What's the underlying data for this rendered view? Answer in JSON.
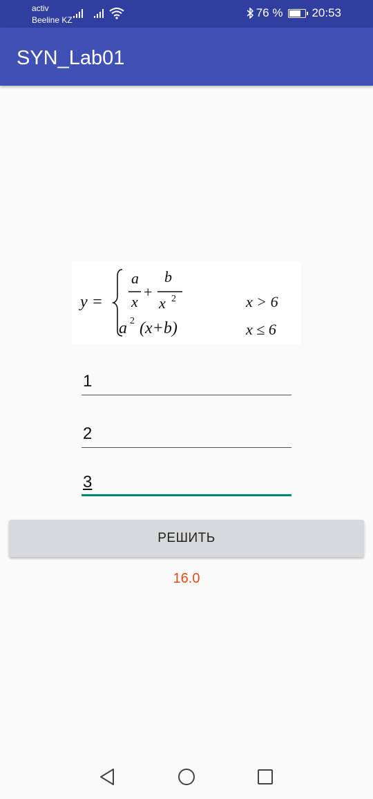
{
  "status_bar": {
    "carrier_line1": "activ",
    "carrier_line2": "Beeline KZ",
    "battery_percent": "76 %",
    "battery_level": 0.76,
    "time": "20:53",
    "icons": [
      "signal-icon",
      "signal-icon",
      "wifi-icon",
      "bluetooth-icon",
      "battery-icon"
    ]
  },
  "app_bar": {
    "title": "SYN_Lab01"
  },
  "formula": {
    "lhs": "y =",
    "case1_num_a": "a",
    "case1_den_x": "x",
    "case1_plus": "+",
    "case1_num_b": "b",
    "case1_den_x2": "x",
    "case1_exp": "2",
    "case2_a": "a",
    "case2_exp": "2",
    "case2_rest": "(x+b)",
    "cond1": "x > 6",
    "cond2": "x ≤ 6"
  },
  "inputs": [
    {
      "value": "1"
    },
    {
      "value": "2"
    },
    {
      "value": "3"
    }
  ],
  "solve_button": {
    "label": "РЕШИТЬ"
  },
  "result": {
    "text": "16.0"
  },
  "colors": {
    "status_bar": "#303f9f",
    "app_bar": "#3f51b5",
    "accent": "#00897b",
    "result": "#e64a19"
  },
  "nav": {
    "icons": [
      "back-icon",
      "home-icon",
      "recents-icon"
    ]
  }
}
